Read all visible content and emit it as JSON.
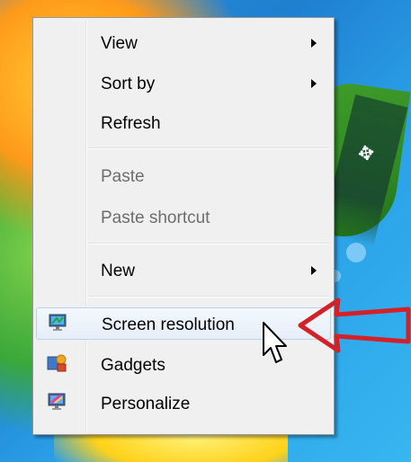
{
  "menu": {
    "items": [
      {
        "label": "View",
        "submenu": true,
        "enabled": true
      },
      {
        "label": "Sort by",
        "submenu": true,
        "enabled": true
      },
      {
        "label": "Refresh",
        "submenu": false,
        "enabled": true
      },
      {
        "label": "Paste",
        "submenu": false,
        "enabled": false
      },
      {
        "label": "Paste shortcut",
        "submenu": false,
        "enabled": false
      },
      {
        "label": "New",
        "submenu": true,
        "enabled": true
      },
      {
        "label": "Screen resolution",
        "submenu": false,
        "enabled": true,
        "highlighted": true,
        "icon": "monitor-icon"
      },
      {
        "label": "Gadgets",
        "submenu": false,
        "enabled": true,
        "icon": "gadgets-icon"
      },
      {
        "label": "Personalize",
        "submenu": false,
        "enabled": true,
        "icon": "personalize-icon"
      }
    ]
  },
  "colors": {
    "annotation_arrow": "#d42027",
    "highlight_border": "#b8d2ee",
    "menu_background": "#f0f0f0"
  }
}
